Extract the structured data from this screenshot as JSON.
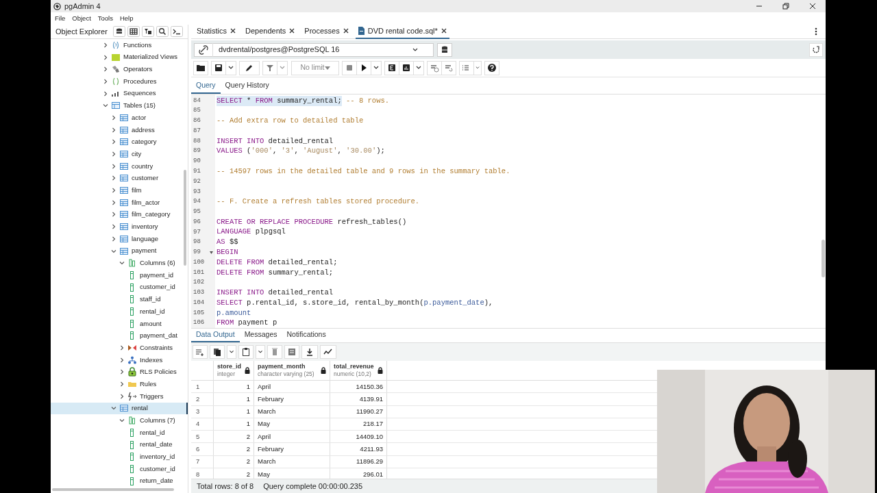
{
  "window": {
    "title": "pgAdmin 4"
  },
  "menu": [
    "File",
    "Object",
    "Tools",
    "Help"
  ],
  "explorer": {
    "title": "Object Explorer",
    "tree": [
      {
        "label": "Functions",
        "kind": "function",
        "expanded": false,
        "selected": false
      },
      {
        "label": "Materialized Views",
        "kind": "matview",
        "expanded": false,
        "selected": false
      },
      {
        "label": "Operators",
        "kind": "operator",
        "expanded": false,
        "selected": false
      },
      {
        "label": "Procedures",
        "kind": "procedure",
        "expanded": false,
        "selected": false
      },
      {
        "label": "Sequences",
        "kind": "sequence",
        "expanded": false,
        "selected": false
      },
      {
        "label": "Tables (15)",
        "kind": "tables",
        "expanded": true,
        "selected": false,
        "children": [
          {
            "label": "actor",
            "kind": "table",
            "expanded": false,
            "selected": false
          },
          {
            "label": "address",
            "kind": "table",
            "expanded": false,
            "selected": false
          },
          {
            "label": "category",
            "kind": "table",
            "expanded": false,
            "selected": false
          },
          {
            "label": "city",
            "kind": "table",
            "expanded": false,
            "selected": false
          },
          {
            "label": "country",
            "kind": "table",
            "expanded": false,
            "selected": false
          },
          {
            "label": "customer",
            "kind": "table",
            "expanded": false,
            "selected": false
          },
          {
            "label": "film",
            "kind": "table",
            "expanded": false,
            "selected": false
          },
          {
            "label": "film_actor",
            "kind": "table",
            "expanded": false,
            "selected": false
          },
          {
            "label": "film_category",
            "kind": "table",
            "expanded": false,
            "selected": false
          },
          {
            "label": "inventory",
            "kind": "table",
            "expanded": false,
            "selected": false
          },
          {
            "label": "language",
            "kind": "table",
            "expanded": false,
            "selected": false
          },
          {
            "label": "payment",
            "kind": "table",
            "expanded": true,
            "selected": false,
            "children": [
              {
                "label": "Columns (6)",
                "kind": "columns",
                "expanded": true,
                "selected": false,
                "children": [
                  {
                    "label": "payment_id",
                    "kind": "column",
                    "selected": false
                  },
                  {
                    "label": "customer_id",
                    "kind": "column",
                    "selected": false
                  },
                  {
                    "label": "staff_id",
                    "kind": "column",
                    "selected": false
                  },
                  {
                    "label": "rental_id",
                    "kind": "column",
                    "selected": false
                  },
                  {
                    "label": "amount",
                    "kind": "column",
                    "selected": false
                  },
                  {
                    "label": "payment_dat",
                    "kind": "column",
                    "selected": false
                  }
                ]
              },
              {
                "label": "Constraints",
                "kind": "constraint",
                "expanded": false,
                "selected": false
              },
              {
                "label": "Indexes",
                "kind": "index",
                "expanded": false,
                "selected": false
              },
              {
                "label": "RLS Policies",
                "kind": "policy",
                "expanded": false,
                "selected": false
              },
              {
                "label": "Rules",
                "kind": "rule",
                "expanded": false,
                "selected": false
              },
              {
                "label": "Triggers",
                "kind": "trigger",
                "expanded": false,
                "selected": false
              }
            ]
          },
          {
            "label": "rental",
            "kind": "table",
            "expanded": true,
            "selected": true,
            "children": [
              {
                "label": "Columns (7)",
                "kind": "columns",
                "expanded": true,
                "selected": false,
                "children": [
                  {
                    "label": "rental_id",
                    "kind": "column",
                    "selected": false
                  },
                  {
                    "label": "rental_date",
                    "kind": "column",
                    "selected": false
                  },
                  {
                    "label": "inventory_id",
                    "kind": "column",
                    "selected": false
                  },
                  {
                    "label": "customer_id",
                    "kind": "column",
                    "selected": false
                  },
                  {
                    "label": "return_date",
                    "kind": "column",
                    "selected": false
                  }
                ]
              }
            ]
          }
        ]
      }
    ]
  },
  "editor_tabs": [
    {
      "label": "Statistics",
      "kind": "panel",
      "selected": false
    },
    {
      "label": "Dependents",
      "kind": "panel",
      "selected": false
    },
    {
      "label": "Processes",
      "kind": "panel",
      "selected": false
    },
    {
      "label": "DVD rental code.sql*",
      "kind": "file",
      "selected": true
    }
  ],
  "connection": {
    "value": "dvdrental/postgres@PostgreSQL 16"
  },
  "toolbar": {
    "limit": "No limit"
  },
  "query_tabs": [
    {
      "label": "Query",
      "selected": true
    },
    {
      "label": "Query History",
      "selected": false
    }
  ],
  "editor": {
    "lines": [
      {
        "number": "84",
        "tokens": [
          {
            "kind": "keyword",
            "text": "SELECT",
            "selected": true
          },
          {
            "kind": "plain",
            "text": " * ",
            "selected": true
          },
          {
            "kind": "keyword",
            "text": "FROM",
            "selected": true
          },
          {
            "kind": "plain",
            "text": " summary_rental;",
            "selected": true
          },
          {
            "kind": "comment",
            "text": " -- 8 rows.",
            "selected": false
          }
        ]
      },
      {
        "number": "85"
      },
      {
        "number": "86",
        "tokens": [
          {
            "kind": "comment",
            "text": "-- Add extra row to detailed table"
          }
        ]
      },
      {
        "number": "87"
      },
      {
        "number": "88",
        "tokens": [
          {
            "kind": "keyword",
            "text": "INSERT INTO"
          },
          {
            "kind": "plain",
            "text": " detailed_rental"
          }
        ]
      },
      {
        "number": "89",
        "tokens": [
          {
            "kind": "keyword",
            "text": "VALUES"
          },
          {
            "kind": "plain",
            "text": " ("
          },
          {
            "kind": "string",
            "text": "'000'"
          },
          {
            "kind": "plain",
            "text": ", "
          },
          {
            "kind": "string",
            "text": "'3'"
          },
          {
            "kind": "plain",
            "text": ", "
          },
          {
            "kind": "string",
            "text": "'August'"
          },
          {
            "kind": "plain",
            "text": ", "
          },
          {
            "kind": "string",
            "text": "'30.00'"
          },
          {
            "kind": "plain",
            "text": ");"
          }
        ]
      },
      {
        "number": "90"
      },
      {
        "number": "91",
        "tokens": [
          {
            "kind": "comment",
            "text": "-- 14597 rows in the detailed table and 9 rows in the summary table."
          }
        ]
      },
      {
        "number": "92"
      },
      {
        "number": "93"
      },
      {
        "number": "94",
        "tokens": [
          {
            "kind": "comment",
            "text": "-- F. Create a refresh tables stored procedure."
          }
        ]
      },
      {
        "number": "95"
      },
      {
        "number": "96",
        "tokens": [
          {
            "kind": "keyword",
            "text": "CREATE OR REPLACE PROCEDURE"
          },
          {
            "kind": "plain",
            "text": " refresh_tables()"
          }
        ]
      },
      {
        "number": "97",
        "tokens": [
          {
            "kind": "keyword",
            "text": "LANGUAGE"
          },
          {
            "kind": "plain",
            "text": " plpgsql"
          }
        ]
      },
      {
        "number": "98",
        "tokens": [
          {
            "kind": "keyword",
            "text": "AS"
          },
          {
            "kind": "plain",
            "text": " $$"
          }
        ]
      },
      {
        "number": "99",
        "fold": true,
        "tokens": [
          {
            "kind": "keyword",
            "text": "BEGIN"
          }
        ]
      },
      {
        "number": "100",
        "tokens": [
          {
            "kind": "keyword",
            "text": "DELETE FROM"
          },
          {
            "kind": "plain",
            "text": " detailed_rental;"
          }
        ]
      },
      {
        "number": "101",
        "tokens": [
          {
            "kind": "keyword",
            "text": "DELETE FROM"
          },
          {
            "kind": "plain",
            "text": " summary_rental;"
          }
        ]
      },
      {
        "number": "102"
      },
      {
        "number": "103",
        "tokens": [
          {
            "kind": "keyword",
            "text": "INSERT INTO"
          },
          {
            "kind": "plain",
            "text": " detailed_rental"
          }
        ]
      },
      {
        "number": "104",
        "tokens": [
          {
            "kind": "keyword",
            "text": "SELECT"
          },
          {
            "kind": "plain",
            "text": " p.rental_id, s.store_id, rental_by_month("
          },
          {
            "kind": "variable",
            "text": "p.payment_date"
          },
          {
            "kind": "plain",
            "text": "),"
          }
        ]
      },
      {
        "number": "105",
        "tokens": [
          {
            "kind": "variable",
            "text": "p.amount"
          }
        ]
      },
      {
        "number": "106",
        "tokens": [
          {
            "kind": "keyword",
            "text": "FROM"
          },
          {
            "kind": "plain",
            "text": " payment p"
          }
        ]
      }
    ]
  },
  "output_tabs": [
    {
      "label": "Data Output",
      "selected": true
    },
    {
      "label": "Messages",
      "selected": false
    },
    {
      "label": "Notifications",
      "selected": false
    }
  ],
  "grid": {
    "columns": [
      {
        "name": "store_id",
        "type": "integer",
        "kind": "number"
      },
      {
        "name": "payment_month",
        "type": "character varying (25)",
        "kind": "text"
      },
      {
        "name": "total_revenue",
        "type": "numeric (10,2)",
        "kind": "number"
      }
    ],
    "rows": [
      {
        "number": "1",
        "cells": [
          "1",
          "April",
          "14150.36"
        ]
      },
      {
        "number": "2",
        "cells": [
          "1",
          "February",
          "4139.91"
        ]
      },
      {
        "number": "3",
        "cells": [
          "1",
          "March",
          "11990.27"
        ]
      },
      {
        "number": "4",
        "cells": [
          "1",
          "May",
          "218.17"
        ]
      },
      {
        "number": "5",
        "cells": [
          "2",
          "April",
          "14409.10"
        ]
      },
      {
        "number": "6",
        "cells": [
          "2",
          "February",
          "4211.93"
        ]
      },
      {
        "number": "7",
        "cells": [
          "2",
          "March",
          "11896.29"
        ]
      },
      {
        "number": "8",
        "cells": [
          "2",
          "May",
          "296.01"
        ]
      }
    ]
  },
  "status_bar": {
    "total": "Total rows: 8 of 8",
    "message": "Query complete 00:00:00.235"
  },
  "webcam": {
    "kind": "picture"
  }
}
